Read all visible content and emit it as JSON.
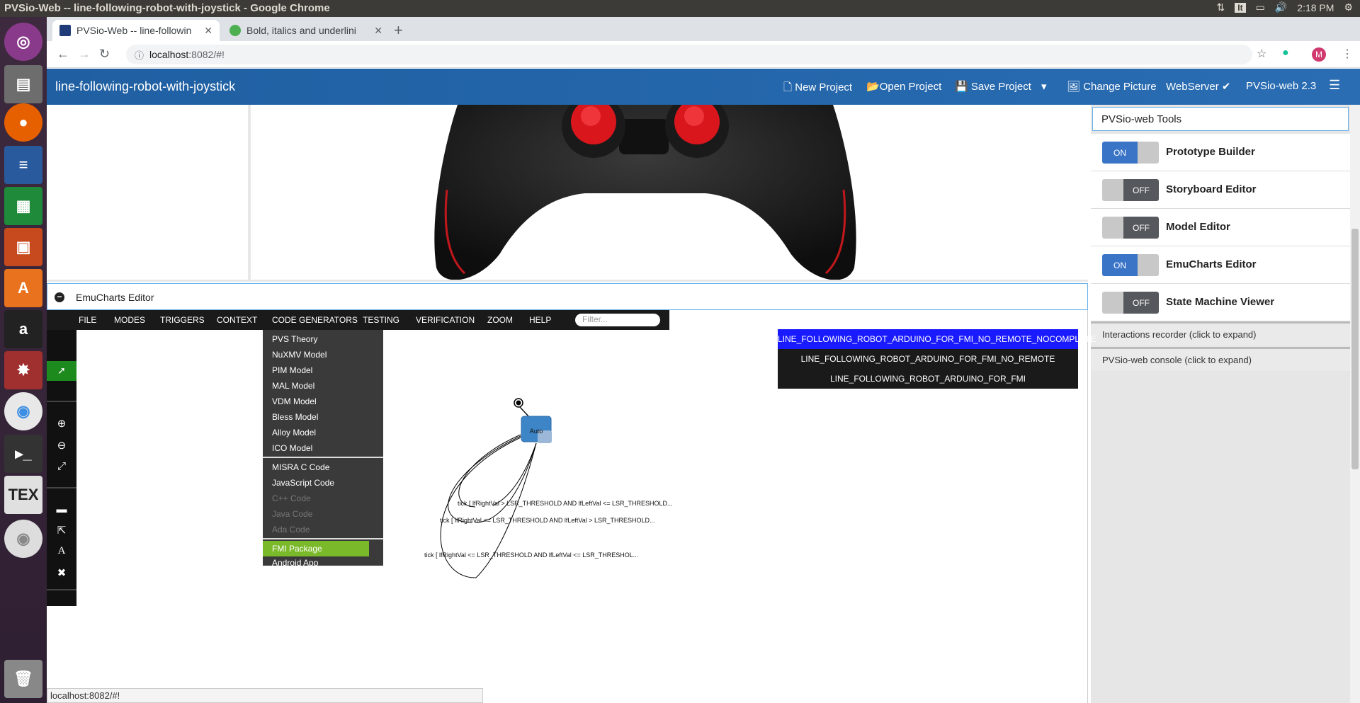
{
  "os": {
    "window_title": "PVSio-Web -- line-following-robot-with-joystick - Google Chrome",
    "keyboard_layout": "It",
    "clock": "2:18 PM"
  },
  "browser": {
    "tabs": [
      {
        "title": "PVSio-Web -- line-followin",
        "active": true
      },
      {
        "title": "Bold, italics and underlini",
        "active": false
      }
    ],
    "url_host": "localhost",
    "url_path": ":8082/#!",
    "profile_initial": "M"
  },
  "app": {
    "project_name": "line-following-robot-with-joystick",
    "header_items": {
      "new_project": "New Project",
      "open_project": "Open Project",
      "save_project": "Save Project",
      "change_picture": "Change Picture",
      "webserver": "WebServer ✔",
      "version": "PVSio-web 2.3"
    }
  },
  "tools_panel": {
    "title": "PVSio-web Tools",
    "tools": [
      {
        "label": "Prototype Builder",
        "state": "ON"
      },
      {
        "label": "Storyboard Editor",
        "state": "OFF"
      },
      {
        "label": "Model Editor",
        "state": "OFF"
      },
      {
        "label": "EmuCharts Editor",
        "state": "ON"
      },
      {
        "label": "State Machine Viewer",
        "state": "OFF"
      }
    ],
    "interactions_recorder": "Interactions recorder (click to expand)",
    "console": "PVSio-web console (click to expand)"
  },
  "emucharts": {
    "title": "EmuCharts Editor",
    "menu": [
      "FILE",
      "MODES",
      "TRIGGERS",
      "CONTEXT",
      "CODE GENERATORS",
      "TESTING",
      "VERIFICATION",
      "ZOOM",
      "HELP"
    ],
    "filter_placeholder": "Filter...",
    "code_generators": {
      "group1": [
        "PVS Theory",
        "NuXMV Model",
        "PIM Model",
        "MAL Model",
        "VDM Model",
        "Bless Model",
        "Alloy Model",
        "ICO Model"
      ],
      "group2": [
        "MISRA C Code",
        "JavaScript Code",
        "C++ Code",
        "Java Code",
        "Ada Code"
      ],
      "group2_disabled": [
        "C++ Code",
        "Java Code",
        "Ada Code"
      ],
      "group3": [
        "FMI Package",
        "Android App"
      ],
      "highlighted": "FMI Package"
    },
    "modules": [
      {
        "name": "LINE_FOLLOWING_ROBOT_ARDUINO_FOR_FMI_NO_REMOTE_NOCOMPLETE",
        "active": true
      },
      {
        "name": "LINE_FOLLOWING_ROBOT_ARDUINO_FOR_FMI_NO_REMOTE",
        "active": false
      },
      {
        "name": "LINE_FOLLOWING_ROBOT_ARDUINO_FOR_FMI",
        "active": false
      }
    ],
    "diagram": {
      "state_name": "Auto",
      "transitions": [
        "tick [ lfRightVal > LSR_THRESHOLD AND lfLeftVal <= LSR_THRESHOLD...",
        "tick [ lfRightVal <= LSR_THRESHOLD AND lfLeftVal > LSR_THRESHOLD...",
        "tick [ lfRightVal <= LSR_THRESHOLD AND lfLeftVal <= LSR_THRESHOL..."
      ]
    }
  },
  "status_url": "localhost:8082/#!",
  "colors": {
    "header_blue": "#1f5fa2",
    "toggle_on": "#3a74c7",
    "menu_highlight": "#7ab92a",
    "module_active": "#1a1aff",
    "state_fill": "#3d85c6"
  }
}
